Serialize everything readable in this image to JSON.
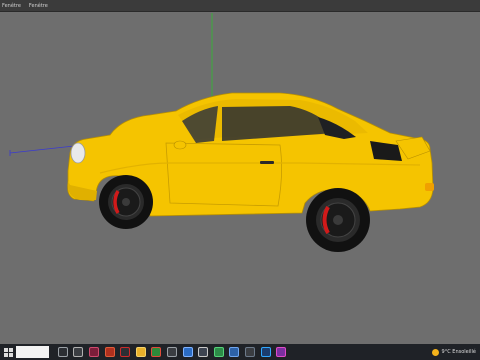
{
  "menubar": {
    "items": [
      "Fenêtre",
      "Fenêtre"
    ]
  },
  "viewport": {
    "subject": "yellow classic coupe 3D model"
  },
  "taskbar": {
    "search_placeholder": "",
    "apps": [
      {
        "name": "task-view",
        "color": "#2b2e33",
        "border": "#9aa0a6"
      },
      {
        "name": "app-1",
        "color": "#3a3d42",
        "border": "#b0b0b0"
      },
      {
        "name": "app-2",
        "color": "#7c1e3a",
        "border": "#d04a6e"
      },
      {
        "name": "app-3",
        "color": "#b0301e",
        "border": "#e05c3a"
      },
      {
        "name": "app-4",
        "color": "#2d2f34",
        "border": "#cc2b2b"
      },
      {
        "name": "app-5",
        "color": "#e8b12b",
        "border": "#f5d36a"
      },
      {
        "name": "app-6",
        "color": "#2f8a3a",
        "border": "#e04c3a"
      },
      {
        "name": "app-7",
        "color": "#3a3d42",
        "border": "#9aa0a6"
      },
      {
        "name": "app-8",
        "color": "#2b6cc4",
        "border": "#7fb2ff"
      },
      {
        "name": "app-9",
        "color": "#3d4451",
        "border": "#c8c8c8"
      },
      {
        "name": "app-10",
        "color": "#2c8c48",
        "border": "#55d37a"
      },
      {
        "name": "app-11",
        "color": "#2d62a8",
        "border": "#6fa6f0"
      },
      {
        "name": "app-12",
        "color": "#3a3d42",
        "border": "#6c7a8a"
      },
      {
        "name": "app-13",
        "color": "#1b3d6e",
        "border": "#31a8ff"
      },
      {
        "name": "app-14",
        "color": "#7b2fa0",
        "border": "#e04cc8"
      }
    ],
    "weather_text": "9°C  Ensoleillé"
  },
  "colors": {
    "body_paint": "#f5c400",
    "body_shadow": "#c79c00",
    "tire": "#111111",
    "caliper": "#d11a1a",
    "viewport_bg": "#6e6e6e",
    "axis_green": "#2fbf2f",
    "axis_blue": "#3a3ad0"
  }
}
